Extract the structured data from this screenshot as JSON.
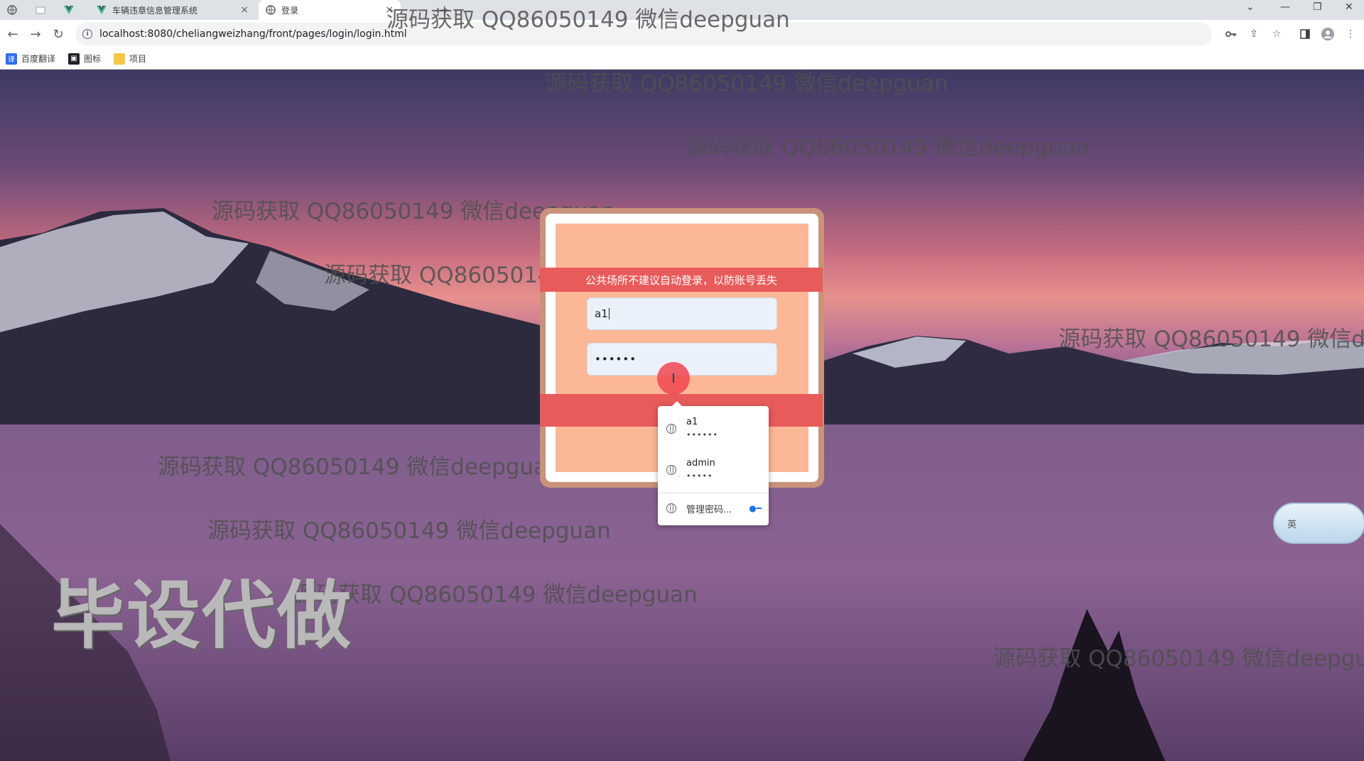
{
  "browser": {
    "tabs": [
      {
        "label": "车辆违章信息管理系统",
        "active": false
      },
      {
        "label": "登录",
        "active": true
      }
    ],
    "url": "localhost:8080/cheliangweizhang/front/pages/login/login.html",
    "bookmarks": [
      {
        "label": "百度翻译"
      },
      {
        "label": "图标"
      },
      {
        "label": "项目"
      }
    ]
  },
  "watermark": {
    "text": "源码获取 QQ86050149 微信deepguan",
    "stamp": "毕设代做"
  },
  "login": {
    "notice": "公共场所不建议自动登录，以防账号丢失",
    "username_value": "a1",
    "password_value": "••••••"
  },
  "autofill": {
    "items": [
      {
        "user": "a1",
        "password": "••••••"
      },
      {
        "user": "admin",
        "password": "•••••"
      }
    ],
    "manage_label": "管理密码..."
  },
  "ime": {
    "label": "英"
  },
  "colors": {
    "accent_red": "#e85b5b",
    "card_fill": "#fbb796",
    "card_border": "#c8937a"
  }
}
